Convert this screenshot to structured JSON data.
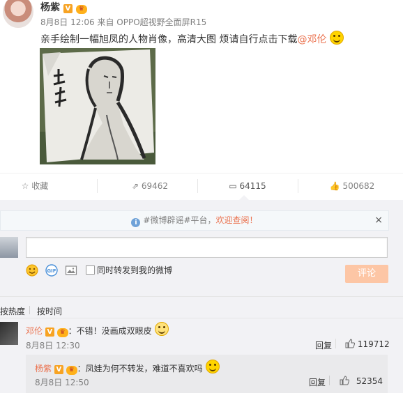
{
  "post": {
    "author": "杨紫",
    "verified_badge": "V",
    "vip_badge": "会员",
    "meta": "8月8日 12:06 来自 OPPO超视野全面屏R15",
    "text": "亲手绘制一幅旭凤的人物肖像，高清大图 烦请自行点击下载",
    "mention": "@邓伦",
    "image_icon": "portrait-sketch-image"
  },
  "actions": {
    "favorite": "收藏",
    "repost_count": "69462",
    "comment_count": "64115",
    "like_count": "500682"
  },
  "notice": {
    "prefix": "#微博辟谣#平台，",
    "link": "欢迎查阅！",
    "close": "×"
  },
  "composer": {
    "repost_checkbox_label": "同时转发到我的微博",
    "submit": "评论",
    "icons": [
      "emoji-icon",
      "gif-icon",
      "image-icon"
    ]
  },
  "sort": {
    "by_hot": "按热度",
    "by_time": "按时间"
  },
  "comments": [
    {
      "user": "邓伦",
      "verified_badge": "V",
      "vip_badge": "会员",
      "text": "：不错！没画成双眼皮",
      "time": "8月8日 12:30",
      "reply": "回复",
      "likes": "119712",
      "reply_thread": {
        "user": "杨紫",
        "verified_badge": "V",
        "vip_badge": "会员",
        "text": "：凤娃为何不转发，难道不喜欢吗",
        "time": "8月8日 12:50",
        "reply": "回复",
        "likes": "52354"
      }
    }
  ],
  "colors": {
    "accent_orange": "#eb7350",
    "submit_disabled": "#fdc6a5",
    "panel_bg": "#f2f2f5"
  }
}
